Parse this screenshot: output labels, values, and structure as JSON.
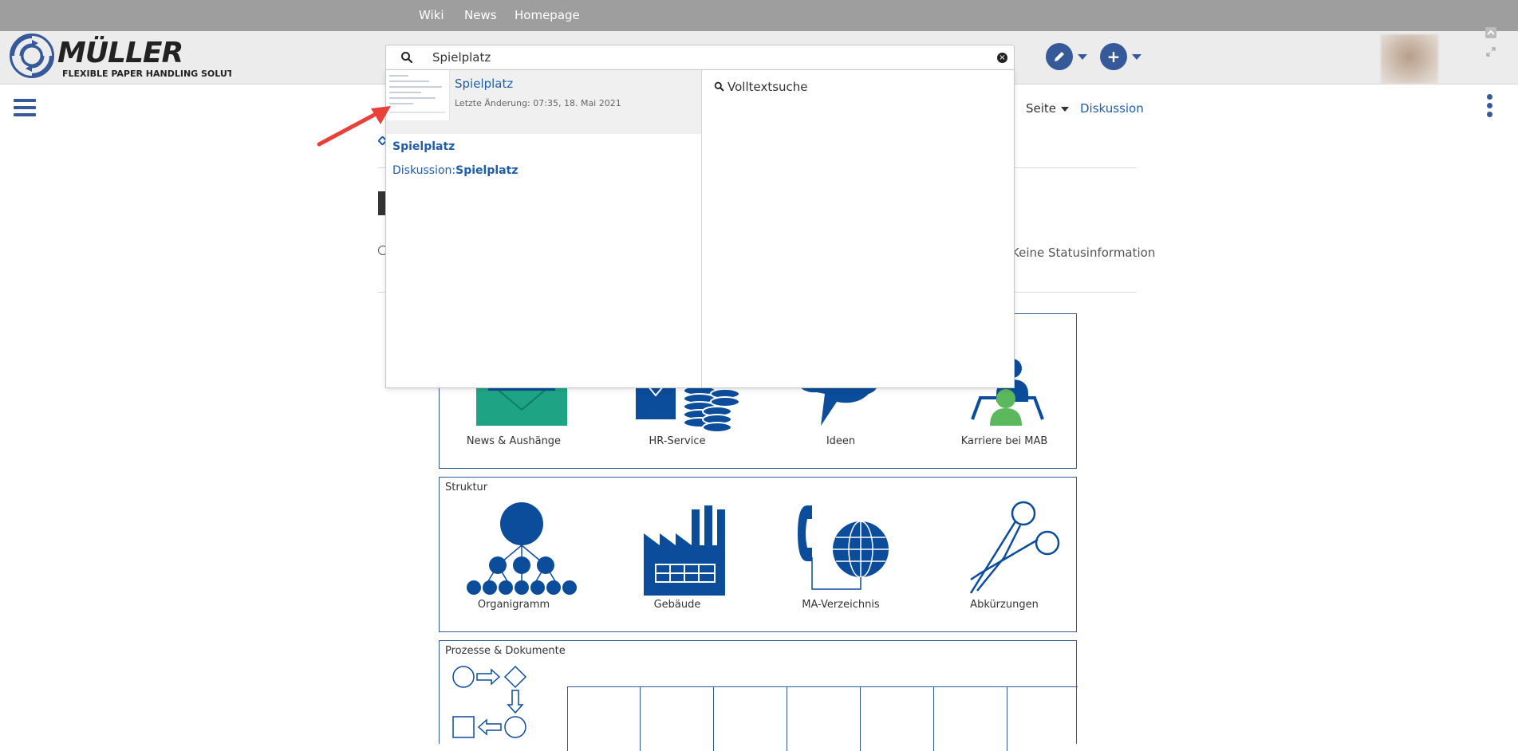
{
  "topnav": {
    "items": [
      {
        "label": "Wiki"
      },
      {
        "label": "News"
      },
      {
        "label": "Homepage"
      }
    ]
  },
  "logo": {
    "name": "MÜLLER",
    "tagline": "FLEXIBLE PAPER HANDLING SOLUTIONS"
  },
  "search": {
    "value": "Spielplatz"
  },
  "dropdown": {
    "top_result": {
      "title": "Spielplatz",
      "meta": "Letzte Änderung: 07:35, 18. Mai 2021"
    },
    "links": [
      {
        "prefix": "",
        "bold": "Spielplatz"
      },
      {
        "prefix": "Diskussion:",
        "bold": "Spielplatz"
      }
    ],
    "fulltext_label": "Volltextsuche"
  },
  "page": {
    "seite_label": "Seite",
    "diskussion_label": "Diskussion",
    "status": "Keine Statusinformation",
    "panel1": {
      "tiles": [
        "News & Aushänge",
        "HR-Service",
        "Ideen",
        "Karriere bei MAB"
      ]
    },
    "panel2": {
      "title": "Struktur",
      "tiles": [
        "Organigramm",
        "Gebäude",
        "MA-Verzeichnis",
        "Abkürzungen"
      ]
    },
    "panel3": {
      "title": "Prozesse & Dokumente"
    }
  },
  "colors": {
    "brand": "#36599a",
    "link": "#1f5ea8",
    "topnav": "#9e9e9e",
    "header": "#ececec",
    "annotation": "#e8413a",
    "green": "#1ea485"
  }
}
